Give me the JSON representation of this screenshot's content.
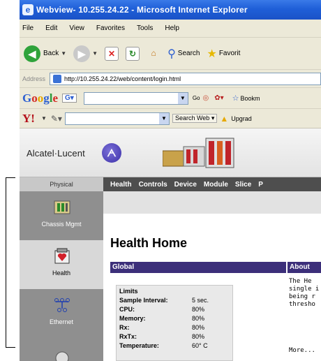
{
  "window": {
    "title": "Webview- 10.255.24.22 - Microsoft Internet Explorer"
  },
  "menu": [
    "File",
    "Edit",
    "View",
    "Favorites",
    "Tools",
    "Help"
  ],
  "toolbar": {
    "back_label": "Back",
    "search_label": "Search",
    "favorites_label": "Favorit"
  },
  "address": {
    "label": "Address",
    "url": "http://10.255.24.22/web/content/login.html"
  },
  "googlebar": {
    "go_label": "Go",
    "bookmarks_label": "Bookm"
  },
  "yahoobar": {
    "search_web_label": "Search Web",
    "upgrade_label": "Upgrad"
  },
  "brand": {
    "name": "Alcatel·Lucent"
  },
  "nav": {
    "physical_tab": "Physical",
    "items": [
      "Health",
      "Controls",
      "Device",
      "Module",
      "Slice",
      "P"
    ]
  },
  "sidebar": {
    "items": [
      {
        "label": "Chassis Mgmt"
      },
      {
        "label": "Health"
      },
      {
        "label": "Ethernet"
      }
    ]
  },
  "content": {
    "title": "Health Home",
    "global_label": "Global",
    "about_label": "About",
    "limits_title": "Limits",
    "limits": [
      {
        "key": "Sample Interval:",
        "value": "5 sec."
      },
      {
        "key": "CPU:",
        "value": "80%"
      },
      {
        "key": "Memory:",
        "value": "80%"
      },
      {
        "key": "Rx:",
        "value": "80%"
      },
      {
        "key": "RxTx:",
        "value": "80%"
      },
      {
        "key": "Temperature:",
        "value": "60° C"
      }
    ],
    "about_lines": [
      "The He",
      "single i",
      "being r",
      "thresho"
    ],
    "more_label": "More..."
  }
}
